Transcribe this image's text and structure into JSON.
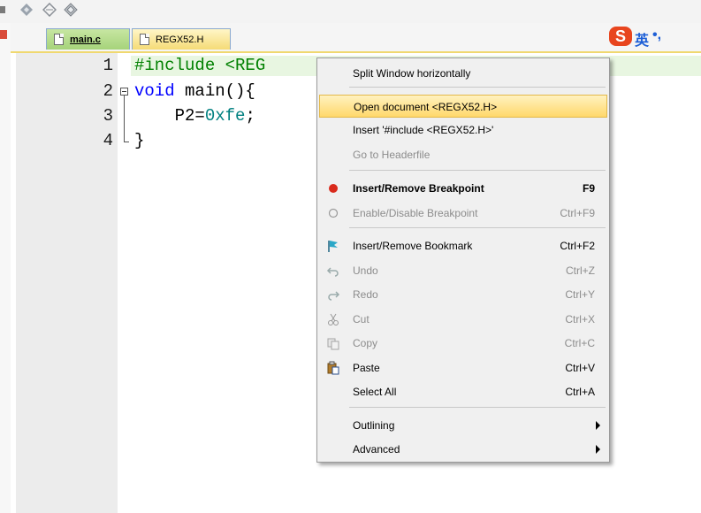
{
  "tabs": [
    {
      "label": "main.c",
      "active": true
    },
    {
      "label": "REGX52.H",
      "active": false
    }
  ],
  "ime": {
    "logo": "S",
    "lang": "英",
    "punct": "•,"
  },
  "editor": {
    "lines": [
      {
        "num": "1",
        "pp": "#include <REG",
        "rest": ""
      },
      {
        "num": "2",
        "kw": "void",
        "rest": " main(){"
      },
      {
        "num": "3",
        "pre": "    P2=",
        "num_lit": "0xfe",
        "post": ";"
      },
      {
        "num": "4",
        "rest": "}"
      }
    ]
  },
  "menu": {
    "items": [
      {
        "label": "Split Window horizontally",
        "shortcut": "",
        "icon": ""
      },
      {
        "label": "Open document <REGX52.H>",
        "shortcut": "",
        "icon": "",
        "highlighted": true
      },
      {
        "label": "Insert '#include <REGX52.H>'",
        "shortcut": "",
        "icon": ""
      },
      {
        "label": "Go to Headerfile",
        "shortcut": "",
        "icon": "",
        "disabled": true
      },
      {
        "label": "Insert/Remove Breakpoint",
        "shortcut": "F9",
        "icon": "breakpoint-icon",
        "bold": true
      },
      {
        "label": "Enable/Disable Breakpoint",
        "shortcut": "Ctrl+F9",
        "icon": "breakpoint-outline-icon",
        "disabled": true
      },
      {
        "label": "Insert/Remove Bookmark",
        "shortcut": "Ctrl+F2",
        "icon": "bookmark-flag-icon"
      },
      {
        "label": "Undo",
        "shortcut": "Ctrl+Z",
        "icon": "undo-icon",
        "disabled": true
      },
      {
        "label": "Redo",
        "shortcut": "Ctrl+Y",
        "icon": "redo-icon",
        "disabled": true
      },
      {
        "label": "Cut",
        "shortcut": "Ctrl+X",
        "icon": "scissors-icon",
        "disabled": true
      },
      {
        "label": "Copy",
        "shortcut": "Ctrl+C",
        "icon": "copy-icon",
        "disabled": true
      },
      {
        "label": "Paste",
        "shortcut": "Ctrl+V",
        "icon": "paste-icon"
      },
      {
        "label": "Select All",
        "shortcut": "Ctrl+A",
        "icon": ""
      },
      {
        "label": "Outlining",
        "shortcut": "",
        "icon": "",
        "submenu": true
      },
      {
        "label": "Advanced",
        "shortcut": "",
        "icon": "",
        "submenu": true
      }
    ]
  },
  "colors": {
    "highlight": "#ffd86b",
    "active_tab": "#a6d37a",
    "breakpoint": "#d92a1c"
  }
}
